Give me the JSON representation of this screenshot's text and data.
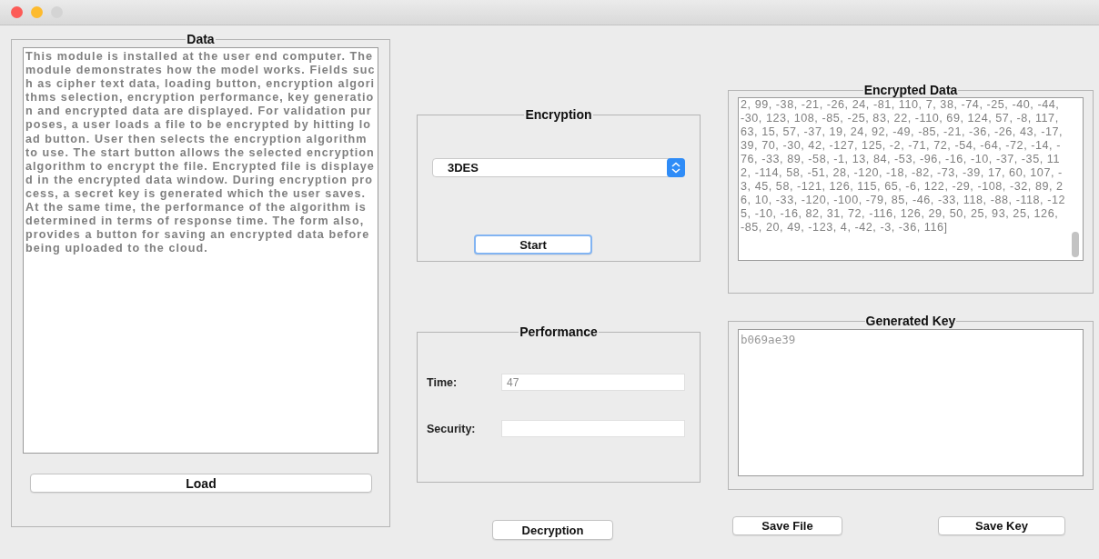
{
  "window": {
    "controls": [
      {
        "color": "#fc5b57"
      },
      {
        "color": "#fdbb2e"
      },
      {
        "color": "#d4d4d4"
      }
    ]
  },
  "data_panel": {
    "title": "Data",
    "text": "This module is installed at the user end computer. The module demonstrates how the model works. Fields such as cipher text data, loading button, encryption algorithms selection, encryption performance, key generation and encrypted data are displayed. For validation purposes, a user loads a file to be encrypted by hitting load button. User then selects the encryption algorithm to use. The start button allows the selected encryption algorithm to encrypt the file. Encrypted file is displayed in the encrypted data window. During encryption process, a secret key is generated which the user saves. At the same time, the performance of the algorithm is determined in terms of response time. The form also, provides a button for saving an encrypted data before being uploaded to the cloud.",
    "button": {
      "label": "Load",
      "focused": false
    }
  },
  "encryption_panel": {
    "title": "Encryption",
    "algorithm": "3DES",
    "button": {
      "label": "Start",
      "focused": true
    }
  },
  "performance_panel": {
    "title": "Performance",
    "fields": [
      {
        "label": "Time:",
        "value": "47"
      },
      {
        "label": "Security:"
      }
    ]
  },
  "decryption_button": {
    "label": "Decryption",
    "focused": false
  },
  "encrypted_panel": {
    "title": "Encrypted Data",
    "text": "2, 99, -38, -21, -26, 24, -81, 110, 7, 38, -74, -25, -40, -44, -30, 123, 108, -85, -25, 83, 22, -110, 69, 124, 57, -8, 117, 63, 15, 57, -37, 19, 24, 92, -49, -85, -21, -36, -26, 43, -17, 39, 70, -30, 42, -127, 125, -2, -71, 72, -54, -64, -72, -14, -76, -33, 89, -58, -1, 13, 84, -53, -96, -16, -10, -37, -35, 112, -114, 58, -51, 28, -120, -18, -82, -73, -39, 17, 60, 107, -3, 45, 58, -121, 126, 115, 65, -6, 122, -29, -108, -32, 89, 26, 10, -33, -120, -100, -79, 85, -46, -33, 118, -88, -118, -125, -10, -16, 82, 31, 72, -116, 126, 29, 50, 25, 93, 25, 126, -85, 20, 49, -123, 4, -42, -3, -36, 116]"
  },
  "key_panel": {
    "title": "Generated Key",
    "text": "b069ae39"
  },
  "bottom_buttons": [
    {
      "label": "Save File",
      "focused": false
    },
    {
      "label": "Save Key",
      "focused": false
    }
  ]
}
